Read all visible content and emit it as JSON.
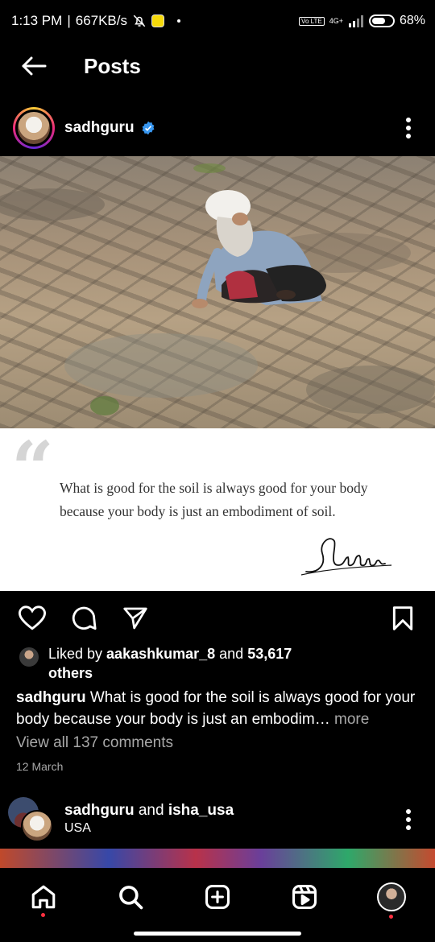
{
  "status_bar": {
    "time": "1:13 PM",
    "speed": "667KB/s",
    "network": "4G+",
    "volte": "Vo LTE",
    "battery": "68%",
    "battery_level": 0.68
  },
  "header": {
    "title": "Posts"
  },
  "post": {
    "username": "sadhguru",
    "verified": true,
    "quote_line1": "What is good for the soil is always good for your body",
    "quote_line2": "because your body is just an embodiment of soil.",
    "signature": "Sadhguru",
    "liked_prefix": "Liked by ",
    "liked_user": "aakashkumar_8",
    "liked_and": " and ",
    "liked_count": "53,617",
    "liked_others": "others",
    "caption_user": "sadhguru",
    "caption_text": " What is good for the soil is always good for your body because your body is just an embodim…",
    "caption_more": " more",
    "comments_link": "View all 137 comments",
    "date": "12 March"
  },
  "next_post": {
    "user1": "sadhguru",
    "and": " and ",
    "user2": "isha_usa",
    "location": "USA"
  },
  "colors": {
    "background": "#000000",
    "verified": "#3897f0",
    "muted_text": "#a8a8a8",
    "notification_dot": "#ff3040"
  },
  "icons": {
    "back": "arrow-left-icon",
    "more": "more-vertical-icon",
    "like": "heart-icon",
    "comment": "comment-icon",
    "share": "send-icon",
    "save": "bookmark-icon",
    "home": "home-icon",
    "search": "search-icon",
    "create": "plus-square-icon",
    "reels": "reels-icon",
    "profile": "profile-avatar"
  }
}
